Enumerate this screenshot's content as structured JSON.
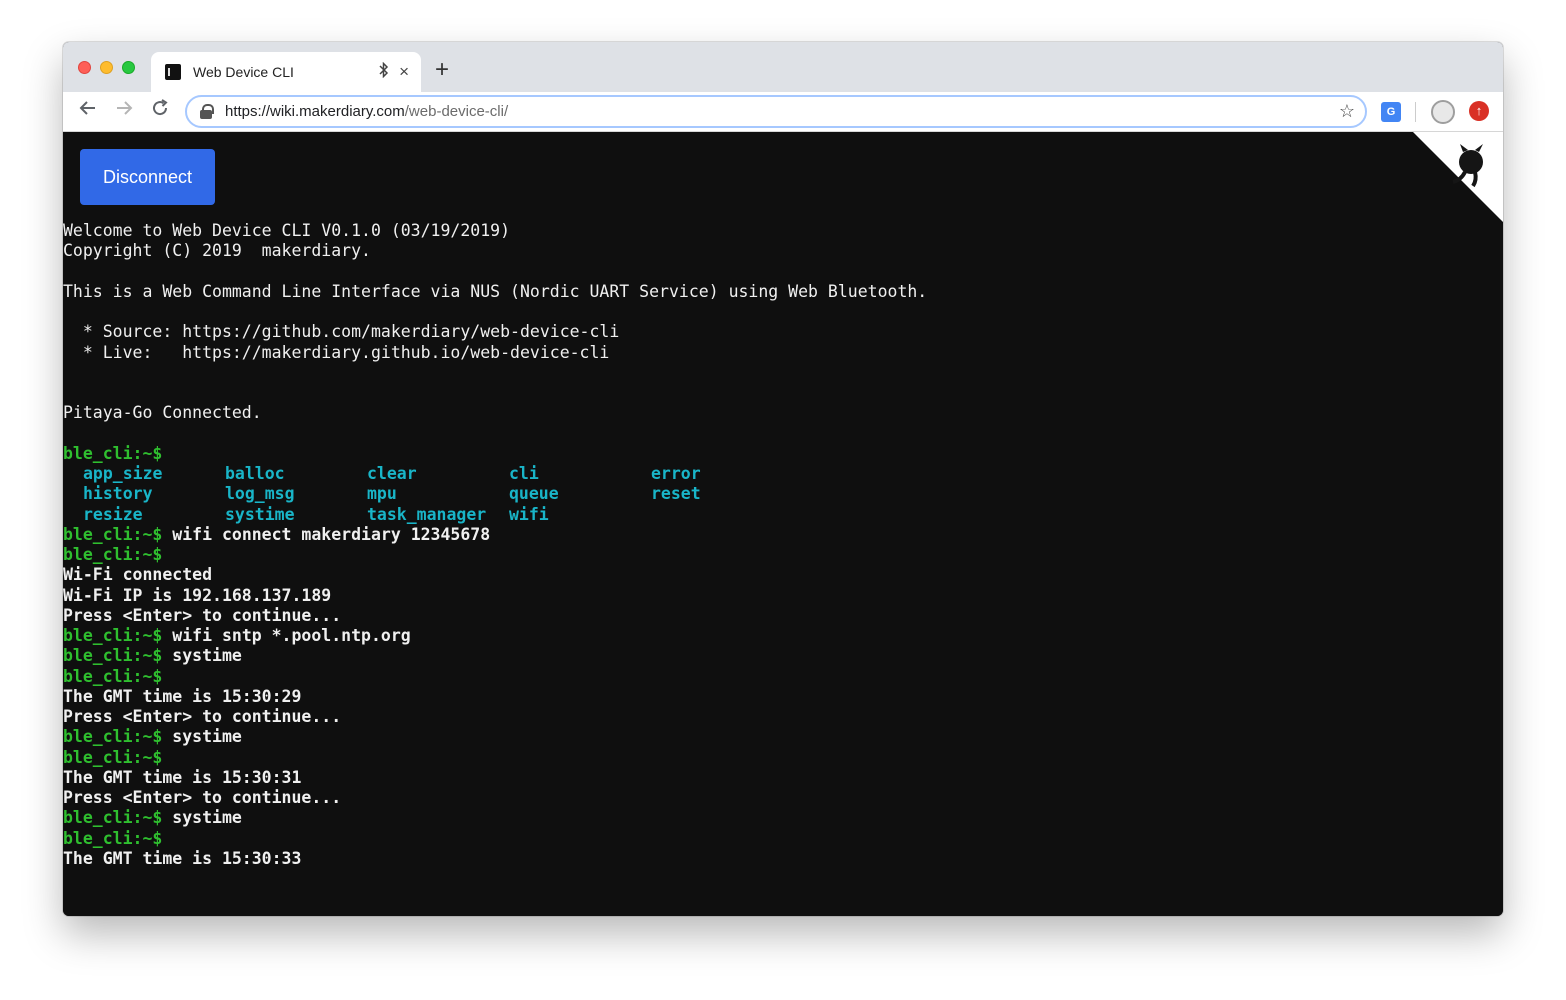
{
  "browser": {
    "tab_title": "Web Device CLI",
    "tab_bluetooth_icon": "bluetooth-icon",
    "tab_close": "×",
    "new_tab": "+",
    "url_host": "https://wiki.makerdiary.com",
    "url_path": "/web-device-cli/",
    "translate_label": "G"
  },
  "page": {
    "disconnect_label": "Disconnect",
    "intro_lines": [
      "Welcome to Web Device CLI V0.1.0 (03/19/2019)",
      "Copyright (C) 2019  makerdiary.",
      "",
      "This is a Web Command Line Interface via NUS (Nordic UART Service) using Web Bluetooth.",
      "",
      "  * Source: https://github.com/makerdiary/web-device-cli",
      "  * Live:   https://makerdiary.github.io/web-device-cli",
      "",
      "",
      "Pitaya-Go Connected.",
      ""
    ],
    "prompt": "ble_cli:~$",
    "commands": [
      [
        "app_size",
        "balloc",
        "clear",
        "cli",
        "error"
      ],
      [
        "history",
        "log_msg",
        "mpu",
        "queue",
        "reset"
      ],
      [
        "resize",
        "systime",
        "task_manager",
        "wifi"
      ]
    ],
    "session": [
      {
        "type": "prompt",
        "cmd": "wifi connect makerdiary 12345678"
      },
      {
        "type": "prompt",
        "cmd": ""
      },
      {
        "type": "output",
        "text": "Wi-Fi connected"
      },
      {
        "type": "output",
        "text": "Wi-Fi IP is 192.168.137.189"
      },
      {
        "type": "output",
        "text": "Press <Enter> to continue..."
      },
      {
        "type": "prompt",
        "cmd": "wifi sntp *.pool.ntp.org"
      },
      {
        "type": "prompt",
        "cmd": "systime"
      },
      {
        "type": "prompt",
        "cmd": ""
      },
      {
        "type": "output",
        "text": "The GMT time is 15:30:29"
      },
      {
        "type": "output",
        "text": "Press <Enter> to continue..."
      },
      {
        "type": "prompt",
        "cmd": "systime"
      },
      {
        "type": "prompt",
        "cmd": ""
      },
      {
        "type": "output",
        "text": "The GMT time is 15:30:31"
      },
      {
        "type": "output",
        "text": "Press <Enter> to continue..."
      },
      {
        "type": "prompt",
        "cmd": "systime"
      },
      {
        "type": "prompt",
        "cmd": ""
      },
      {
        "type": "output",
        "text": "The GMT time is 15:30:33"
      }
    ]
  },
  "colors": {
    "prompt": "#2fbf2f",
    "command_list": "#19b5c8",
    "button": "#3169e7",
    "background": "#0f0f0f"
  }
}
